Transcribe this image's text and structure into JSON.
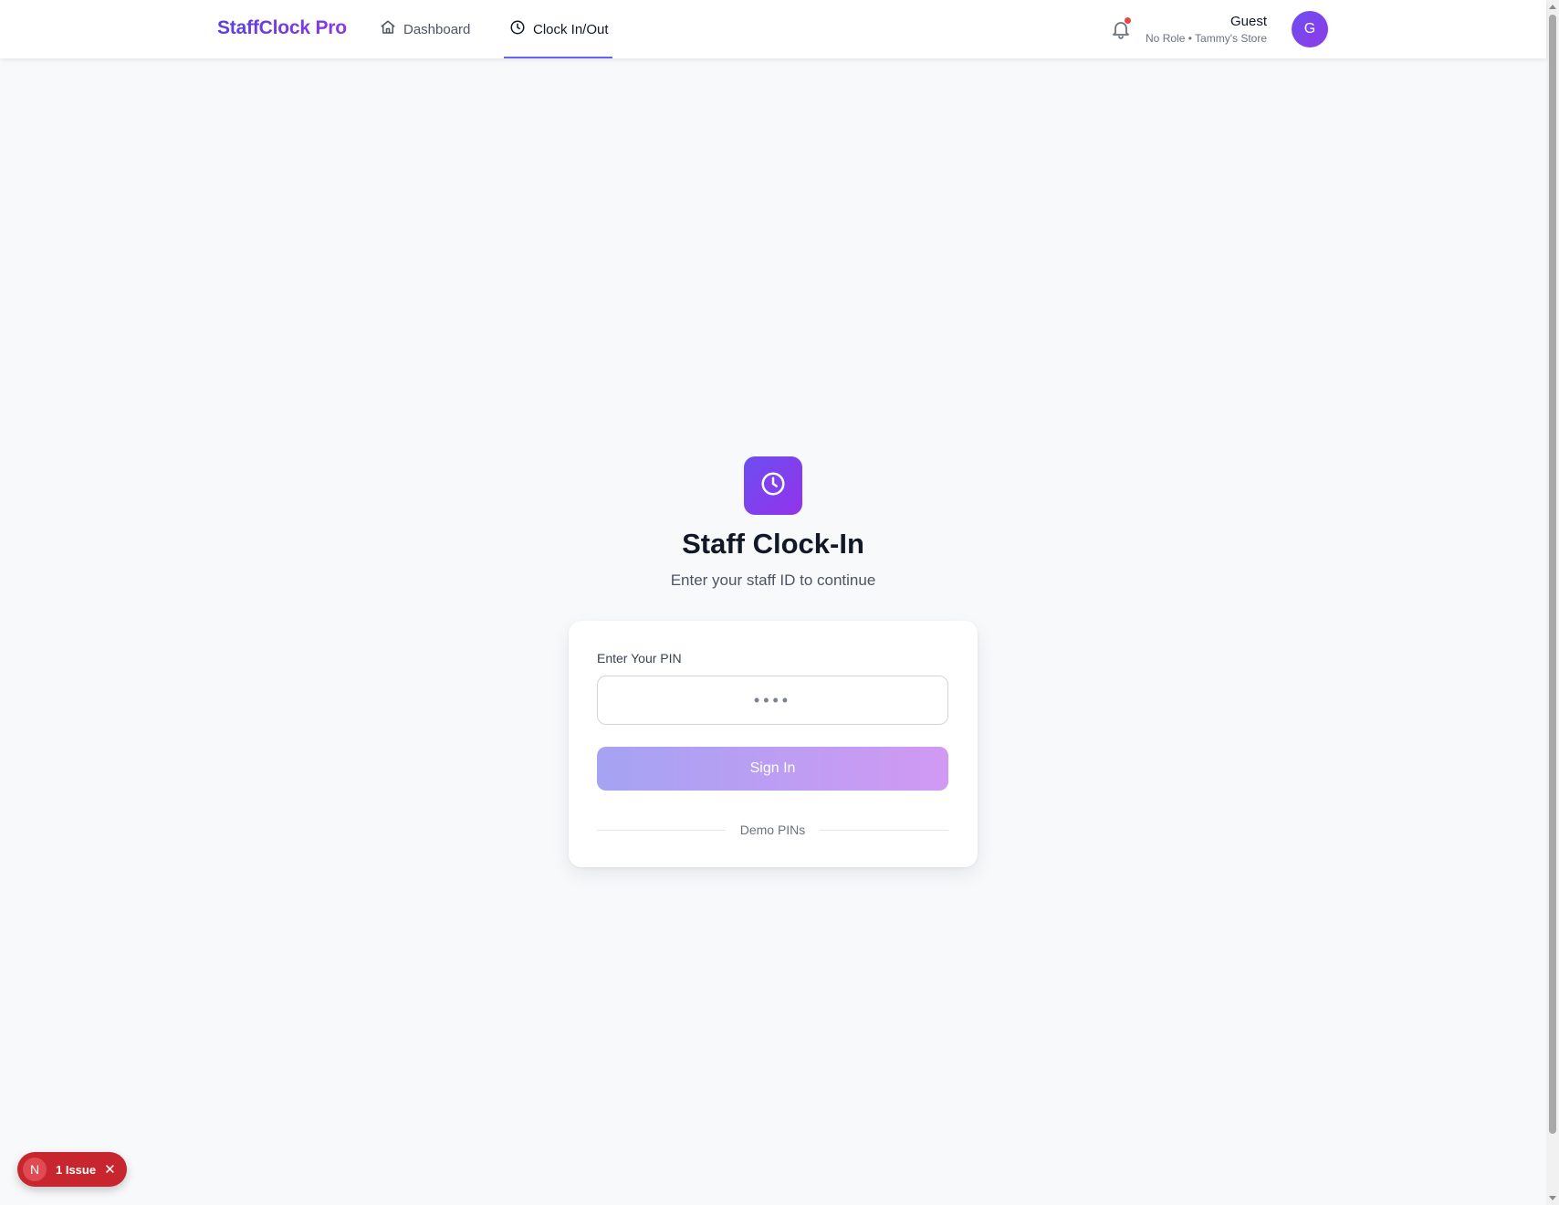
{
  "header": {
    "brand": "StaffClock Pro",
    "nav": [
      {
        "label": "Dashboard",
        "icon": "home-icon",
        "active": false
      },
      {
        "label": "Clock In/Out",
        "icon": "clock-icon",
        "active": true
      }
    ],
    "notifications": {
      "icon": "bell-icon",
      "has_unread": true
    },
    "user": {
      "name": "Guest",
      "meta": "No Role • Tammy's Store",
      "avatar_initial": "G"
    }
  },
  "main": {
    "icon": "clock-icon",
    "title": "Staff Clock-In",
    "subtitle": "Enter your staff ID to continue",
    "form": {
      "pin_label": "Enter Your PIN",
      "pin_placeholder": "••••",
      "pin_value": "",
      "submit_label": "Sign In",
      "divider_text": "Demo PINs"
    }
  },
  "dev_overlay": {
    "logo_letter": "N",
    "issues_label": "1 Issue",
    "close_icon": "close-icon"
  },
  "colors": {
    "accent": "#6366f1",
    "brand_gradient": [
      "#5b3fe0",
      "#8a38e4"
    ],
    "button_gradient": [
      "#a5a3f3",
      "#d199f3"
    ],
    "issue_red": "#c8262f",
    "notification_dot": "#ef4444",
    "background": "#f8f9fb"
  }
}
